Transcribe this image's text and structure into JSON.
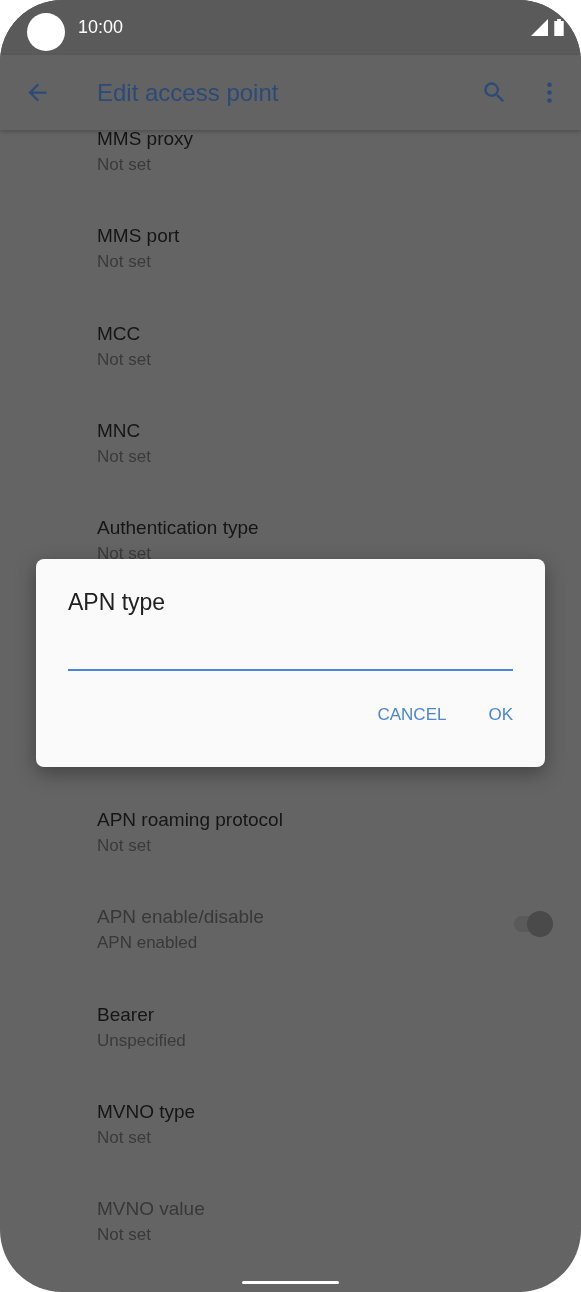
{
  "status_bar": {
    "time": "10:00"
  },
  "app_bar": {
    "title": "Edit access point"
  },
  "items": [
    {
      "kind": "text",
      "title": "MMS proxy",
      "value": "Not set",
      "disabled": false
    },
    {
      "kind": "text",
      "title": "MMS port",
      "value": "Not set",
      "disabled": false
    },
    {
      "kind": "text",
      "title": "MCC",
      "value": "Not set",
      "disabled": false
    },
    {
      "kind": "text",
      "title": "MNC",
      "value": "Not set",
      "disabled": false
    },
    {
      "kind": "text",
      "title": "Authentication type",
      "value": "Not set",
      "disabled": false
    },
    {
      "kind": "hidden"
    },
    {
      "kind": "hidden"
    },
    {
      "kind": "text",
      "title": "APN roaming protocol",
      "value": "Not set",
      "disabled": false
    },
    {
      "kind": "switch",
      "title": "APN enable/disable",
      "value": "APN enabled",
      "disabled": true,
      "on": true
    },
    {
      "kind": "text",
      "title": "Bearer",
      "value": "Unspecified",
      "disabled": false
    },
    {
      "kind": "text",
      "title": "MVNO type",
      "value": "Not set",
      "disabled": false
    },
    {
      "kind": "text",
      "title": "MVNO value",
      "value": "Not set",
      "disabled": true
    }
  ],
  "dialog": {
    "title": "APN type",
    "buttons": [
      "CANCEL",
      "OK"
    ]
  }
}
